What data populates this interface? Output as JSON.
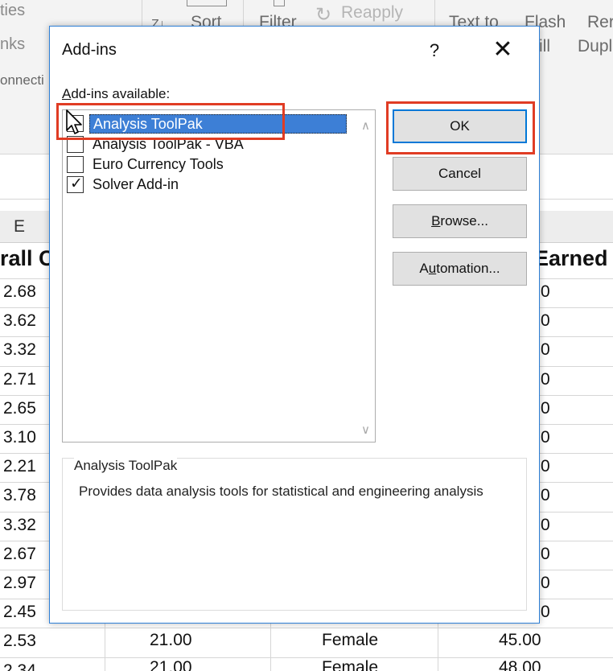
{
  "ribbon": {
    "left_labels": [
      "ties",
      "nks",
      "onnecti"
    ],
    "sort_label": "Sort",
    "sort_prefix": "Z↓",
    "filter_label": "Filter",
    "reapply_label": "Reapply",
    "text_to_label": "Text to",
    "flash_label": "Flash",
    "flash_line2": "ill",
    "remove_label": "Rer",
    "remove_line2": "Dupl"
  },
  "sheet": {
    "column_letter": "E",
    "header_overall": "rall C",
    "header_earned": "Earned",
    "gpa_values": [
      "2.68",
      "3.62",
      "3.32",
      "2.71",
      "2.65",
      "3.10",
      "2.21",
      "3.78",
      "3.32",
      "2.67",
      "2.97",
      "2.45",
      "2.53",
      "2.34"
    ],
    "earned_fragments": [
      "0",
      "0",
      "0",
      "0",
      "0",
      "0",
      "0",
      "0",
      "0",
      "0",
      "0",
      "0"
    ],
    "row_13": {
      "age": "21.00",
      "gender": "Female",
      "earned": "45.00"
    },
    "row_14": {
      "age": "21.00",
      "gender": "Female",
      "earned": "48.00"
    }
  },
  "dialog": {
    "title": "Add-ins",
    "help_label": "?",
    "close_label": "✕",
    "list_label_accel": "A",
    "list_label_rest": "dd-ins available:",
    "items": [
      {
        "label": "Analysis ToolPak",
        "checked": false,
        "selected": true
      },
      {
        "label": "Analysis ToolPak - VBA",
        "checked": false,
        "selected": false
      },
      {
        "label": "Euro Currency Tools",
        "checked": false,
        "selected": false
      },
      {
        "label": "Solver Add-in",
        "checked": true,
        "selected": false
      }
    ],
    "check_glyph": "✓",
    "scroll_up": "∧",
    "scroll_down": "∨",
    "buttons": {
      "ok": "OK",
      "cancel": "Cancel",
      "browse_accel": "B",
      "browse_rest": "rowse...",
      "automation_pre": "A",
      "automation_accel": "u",
      "automation_rest": "tomation..."
    },
    "description_title": "Analysis ToolPak",
    "description_text": "Provides data analysis tools for statistical and engineering analysis"
  },
  "colors": {
    "highlight": "#e03c24",
    "selection": "#3d7fd6",
    "dialog_border": "#2e7fd6",
    "ok_focus": "#0078d7"
  }
}
